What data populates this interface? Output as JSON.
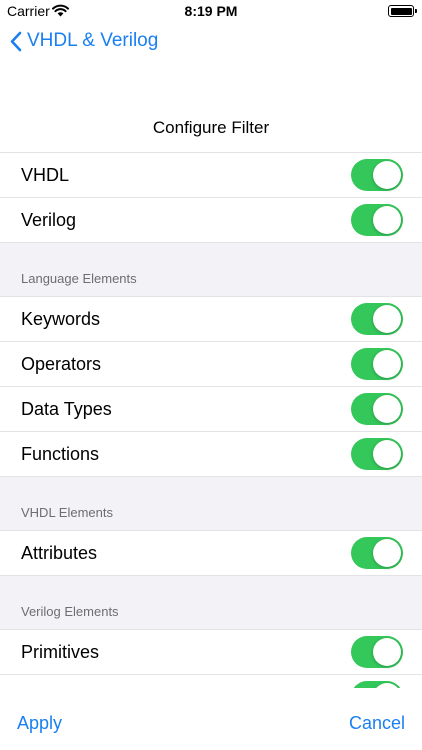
{
  "status": {
    "carrier": "Carrier",
    "time": "8:19 PM",
    "wifi_icon": "wifi-icon",
    "battery_icon": "battery-icon"
  },
  "nav": {
    "back_label": "VHDL & Verilog",
    "back_icon": "chevron-left-icon",
    "accent": "#1a7ff2"
  },
  "title": "Configure Filter",
  "toggle_color": "#34c759",
  "sections": {
    "languages": {
      "items": [
        {
          "label": "VHDL",
          "on": true
        },
        {
          "label": "Verilog",
          "on": true
        }
      ]
    },
    "language_elements": {
      "header": "Language Elements",
      "items": [
        {
          "label": "Keywords",
          "on": true
        },
        {
          "label": "Operators",
          "on": true
        },
        {
          "label": "Data Types",
          "on": true
        },
        {
          "label": "Functions",
          "on": true
        }
      ]
    },
    "vhdl_elements": {
      "header": "VHDL Elements",
      "items": [
        {
          "label": "Attributes",
          "on": true
        }
      ]
    },
    "verilog_elements": {
      "header": "Verilog Elements",
      "items": [
        {
          "label": "Primitives",
          "on": true
        }
      ]
    }
  },
  "bottom": {
    "apply_label": "Apply",
    "cancel_label": "Cancel"
  }
}
